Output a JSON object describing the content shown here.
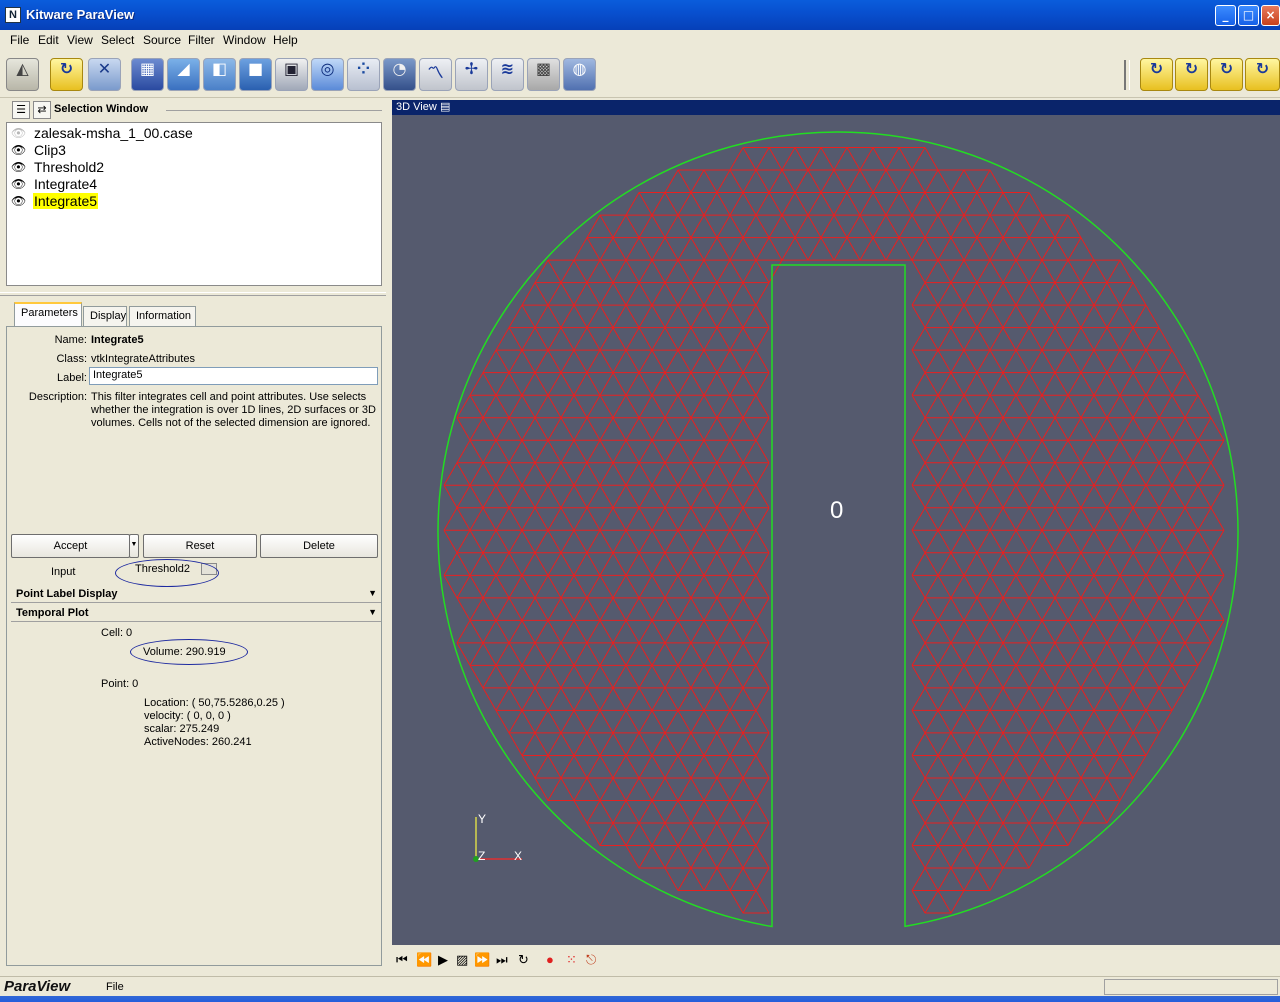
{
  "window": {
    "title": "Kitware ParaView",
    "app_icon": "paraview-logo-icon"
  },
  "menu": [
    "File",
    "Edit",
    "View",
    "Select",
    "Source",
    "Filter",
    "Window",
    "Help"
  ],
  "toolbar_icons": [
    "select-view-icon",
    "rotate-icon",
    "reset-camera-icon",
    "calculator-icon",
    "contour-icon",
    "clip-icon",
    "cut-icon",
    "threshold-icon",
    "extract-grid-icon",
    "warp-icon",
    "glyph-icon",
    "integrate-icon",
    "plot-icon",
    "probe-icon",
    "stream-icon",
    "surface-icon",
    "ruler-icon"
  ],
  "selection_window": {
    "title": "Selection Window",
    "items": [
      {
        "label": "zalesak-msha_1_00.case",
        "visible": false
      },
      {
        "label": "Clip3",
        "visible": true
      },
      {
        "label": "Threshold2",
        "visible": true
      },
      {
        "label": "Integrate4",
        "visible": true
      },
      {
        "label": "Integrate5",
        "visible": true,
        "selected": true
      }
    ]
  },
  "tabs": [
    "Parameters",
    "Display",
    "Information"
  ],
  "params": {
    "name_label": "Name:",
    "name_value": "Integrate5",
    "class_label": "Class:",
    "class_value": "vtkIntegrateAttributes",
    "label_label": "Label:",
    "label_value": "Integrate5",
    "description_label": "Description:",
    "description": "This filter integrates cell and point attributes.  Use selects whether the integration is over 1D lines, 2D surfaces or 3D volumes.  Cells not of the selected dimension are ignored.",
    "accept": "Accept",
    "reset": "Reset",
    "delete": "Delete",
    "input_label": "Input",
    "input_value": "Threshold2",
    "point_label_display": "Point Label Display",
    "temporal_plot": "Temporal Plot",
    "cell_header": "Cell: 0",
    "cell_volume": "Volume: 290.919",
    "point_header": "Point: 0",
    "point_location": "Location: ( 50,75.5286,0.25 )",
    "point_velocity": "velocity: ( 0, 0, 0 )",
    "point_scalar": "scalar: 275.249",
    "point_active": "ActiveNodes: 260.241"
  },
  "view": {
    "title": "3D View",
    "time_label": "0",
    "axes": {
      "y": "Y",
      "z": "Z",
      "x": "X"
    },
    "background": "#555a6e",
    "mesh_color": "#e82020",
    "boundary_color": "#22dd22"
  },
  "status": {
    "logo": "ParaView",
    "text": "File"
  }
}
